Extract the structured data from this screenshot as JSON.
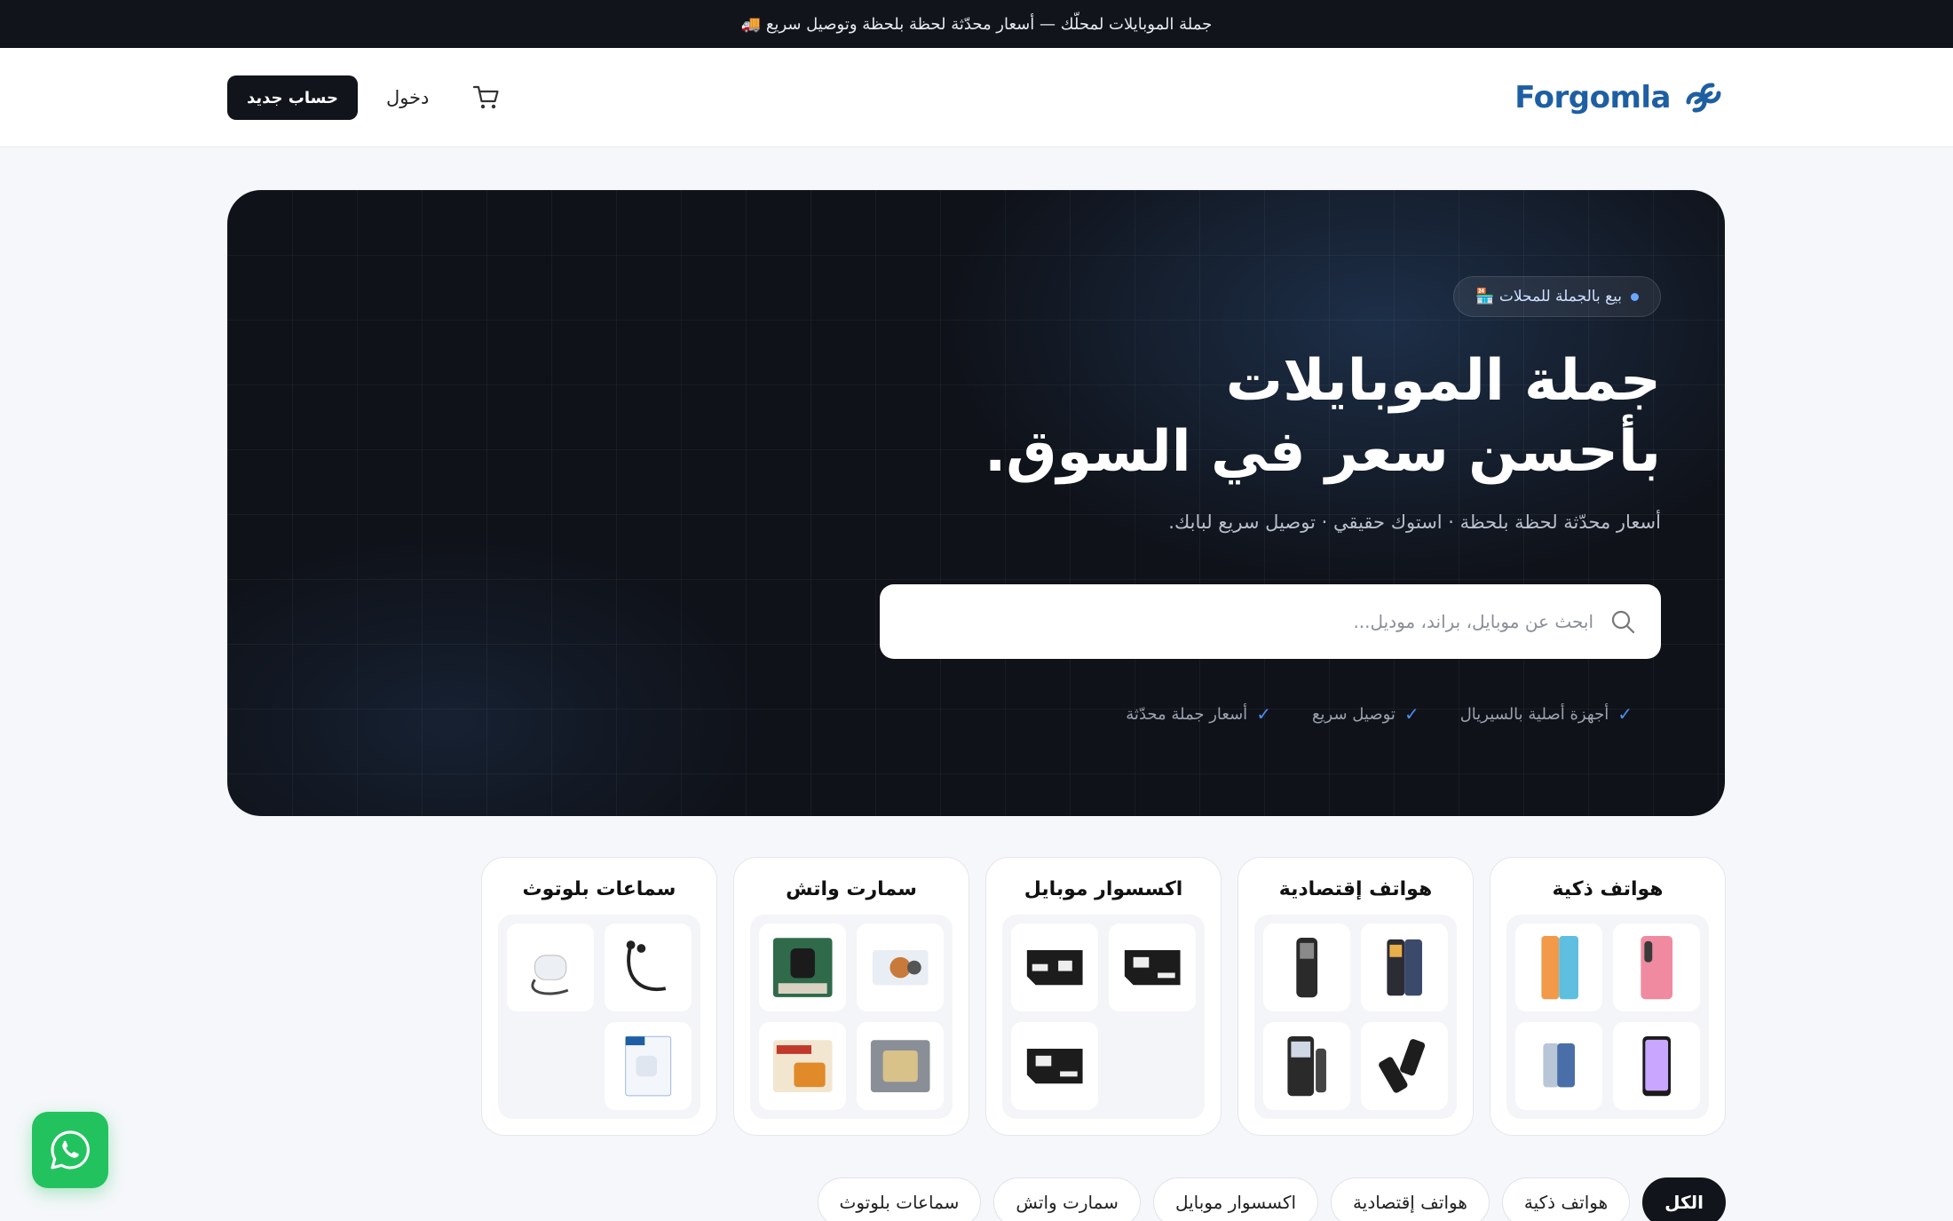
{
  "announcement": {
    "text": "جملة الموبايلات لمحلّك — أسعار محدّثة لحظة بلحظة وتوصيل سريع 🚚"
  },
  "header": {
    "logo_text": "Forgomla",
    "signup_label": "حساب جديد",
    "login_label": "دخول",
    "cart_icon": "cart-icon",
    "brand_color": "#1e5fa3"
  },
  "hero": {
    "badge": "بيع بالجملة للمحلات 🏪",
    "title_line1": "جملة الموبايلات",
    "title_line2": "بأحسن سعر في السوق.",
    "subtitle": "أسعار محدّثة لحظة بلحظة · استوك حقيقي · توصيل سريع لبابك.",
    "search": {
      "placeholder": "ابحث عن موبايل، براند، موديل...",
      "value": ""
    },
    "features": [
      {
        "label": "أجهزة أصلية بالسيريال"
      },
      {
        "label": "توصيل سريع"
      },
      {
        "label": "أسعار جملة محدّثة"
      }
    ]
  },
  "categories": [
    {
      "title": "هواتف ذكية"
    },
    {
      "title": "هواتف إقتصادية"
    },
    {
      "title": "اكسسوار موبايل"
    },
    {
      "title": "سمارت واتش"
    },
    {
      "title": "سماعات بلوتوث"
    }
  ],
  "chips": [
    {
      "label": "الكل",
      "active": true
    },
    {
      "label": "هواتف ذكية"
    },
    {
      "label": "هواتف إقتصادية"
    },
    {
      "label": "اكسسوار موبايل"
    },
    {
      "label": "سمارت واتش"
    },
    {
      "label": "سماعات بلوتوث"
    }
  ],
  "whatsapp": {
    "icon": "whatsapp-icon",
    "color": "#22c35e"
  }
}
